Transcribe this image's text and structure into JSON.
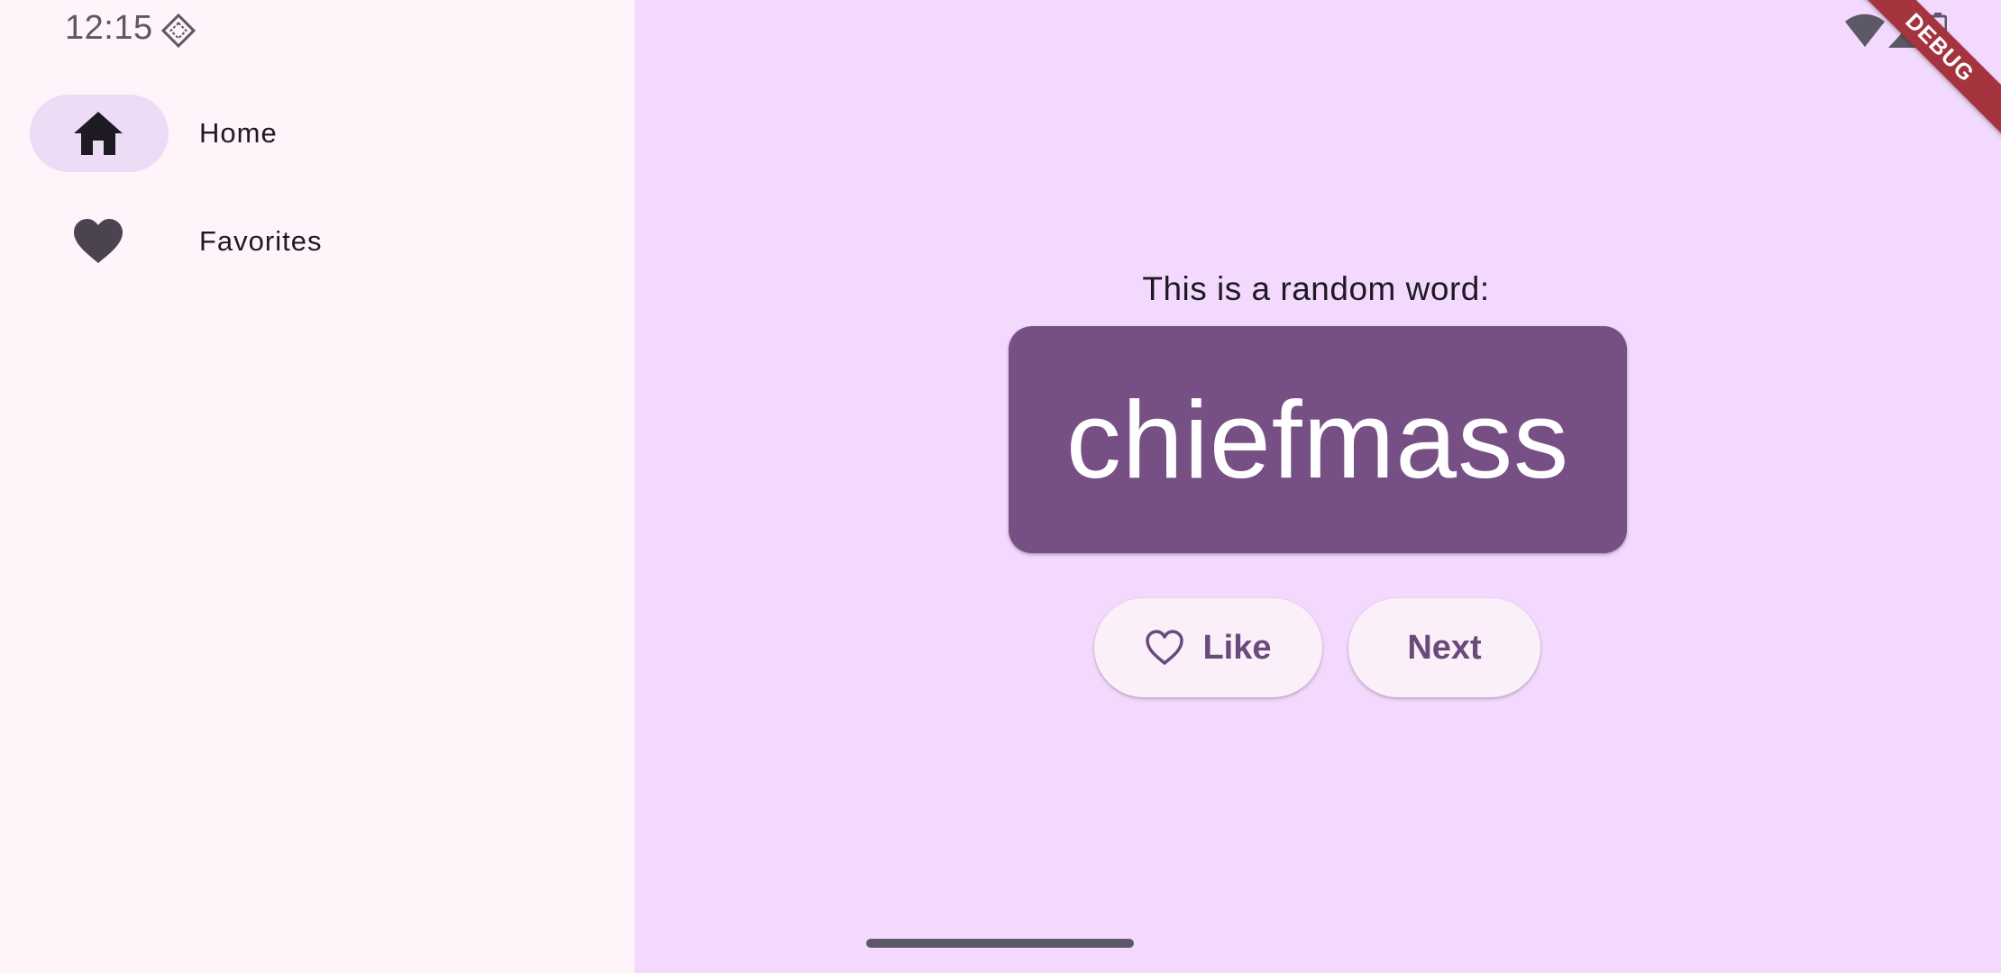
{
  "status_bar": {
    "time": "12:15",
    "app_icon": "notification-diamond-icon",
    "wifi_icon": "wifi-icon",
    "signal_icon": "cell-signal-icon",
    "battery_icon": "battery-icon"
  },
  "debug_banner": "DEBUG",
  "nav_rail": {
    "items": [
      {
        "label": "Home",
        "icon": "home-icon",
        "selected": true
      },
      {
        "label": "Favorites",
        "icon": "heart-icon",
        "selected": false
      }
    ]
  },
  "main": {
    "prompt": "This is a random word:",
    "word": "chiefmass",
    "like_button": {
      "label": "Like",
      "icon": "heart-outline-icon"
    },
    "next_button": {
      "label": "Next"
    }
  },
  "colors": {
    "rail_background": "#fef4fa",
    "main_background": "#f3d9fd",
    "card": "#765085",
    "button_text": "#6a4a7b",
    "selected_pill": "#eedcf6",
    "debug_banner": "#a5343f"
  }
}
